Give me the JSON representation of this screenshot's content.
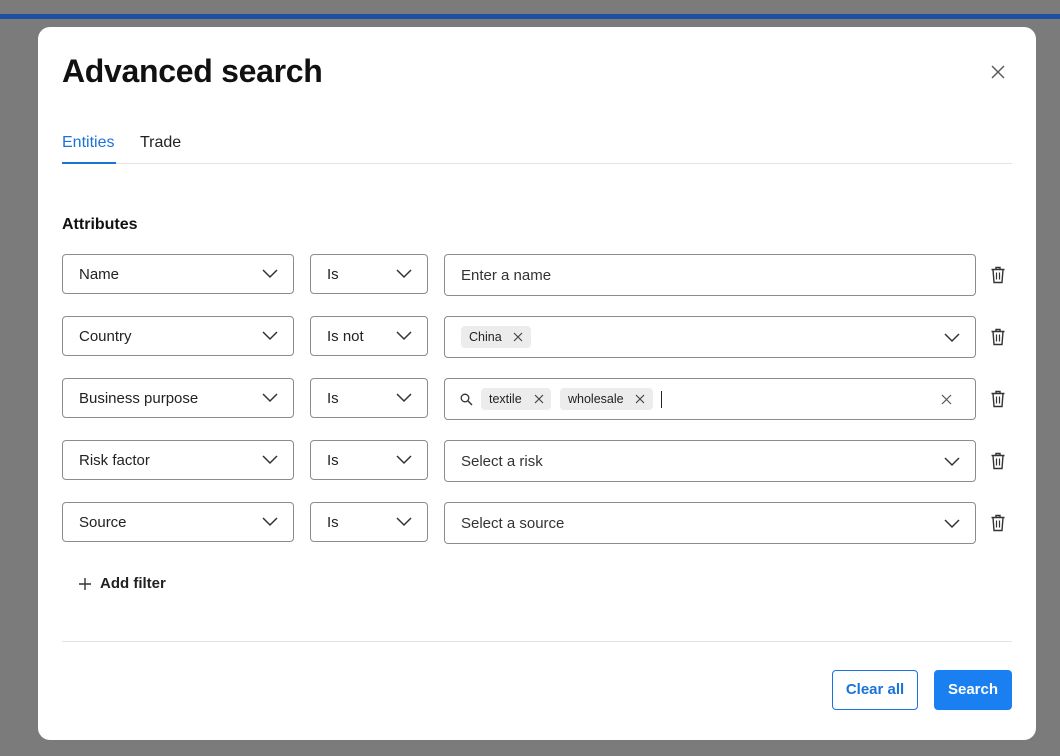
{
  "dialog": {
    "title": "Advanced search",
    "tabs": [
      {
        "label": "Entities",
        "active": true
      },
      {
        "label": "Trade",
        "active": false
      }
    ],
    "section_title": "Attributes",
    "filters": [
      {
        "attribute": "Name",
        "operator": "Is",
        "value_placeholder": "Enter a name"
      },
      {
        "attribute": "Country",
        "operator": "Is not",
        "chips": [
          "China"
        ]
      },
      {
        "attribute": "Business purpose",
        "operator": "Is",
        "chips": [
          "textile",
          "wholesale"
        ]
      },
      {
        "attribute": "Risk factor",
        "operator": "Is",
        "value_placeholder": "Select a risk"
      },
      {
        "attribute": "Source",
        "operator": "Is",
        "value_placeholder": "Select a source"
      }
    ],
    "add_filter_label": "Add filter",
    "clear_label": "Clear all",
    "search_label": "Search"
  },
  "colors": {
    "accent": "#1a73d9",
    "primary_button": "#1a7ff0",
    "overlay": "#7b7b7b",
    "topbar": "#1f4fa0"
  },
  "icons": [
    "close-icon",
    "chevron-down-icon",
    "trash-icon",
    "search-icon",
    "clear-icon",
    "plus-icon"
  ]
}
